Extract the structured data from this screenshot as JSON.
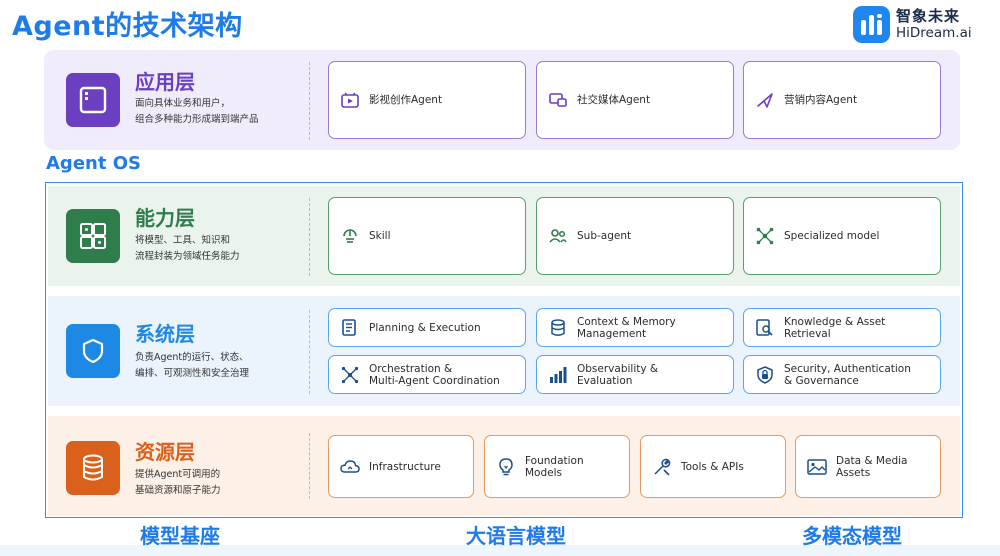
{
  "title": "Agent的技术架构",
  "logo": {
    "cn": "智象未来",
    "en": "HiDream.ai"
  },
  "colors": {
    "title_blue": "#1f7be8",
    "app_purple": "#6a3fc0",
    "cap_green": "#2e7d4a",
    "sys_blue": "#1e88e5",
    "res_orange": "#d9611c"
  },
  "os_label": "Agent OS",
  "layers": {
    "app": {
      "name": "应用层",
      "desc": [
        "面向具体业务和用户，",
        "组合多种能力形成端到端产品"
      ],
      "icon": "app-window-icon",
      "cards": [
        {
          "label": "影视创作Agent",
          "icon": "video-icon"
        },
        {
          "label": "社交媒体Agent",
          "icon": "social-chat-icon"
        },
        {
          "label": "营销内容Agent",
          "icon": "send-arrow-icon"
        }
      ]
    },
    "capability": {
      "name": "能力层",
      "desc": [
        "将模型、工具、知识和",
        "流程封装为领域任务能力"
      ],
      "icon": "grid-blocks-icon",
      "cards": [
        {
          "label": "Skill",
          "icon": "skill-icon"
        },
        {
          "label": "Sub-agent",
          "icon": "users-icon"
        },
        {
          "label": "Specialized model",
          "icon": "network-nodes-icon"
        }
      ]
    },
    "system": {
      "name": "系统层",
      "desc": [
        "负责Agent的运行、状态、",
        "编排、可观测性和安全治理"
      ],
      "icon": "shield-icon",
      "cards": [
        {
          "label": "Planning & Execution",
          "icon": "checklist-icon"
        },
        {
          "label": "Context & Memory\nManagement",
          "icon": "database-icon"
        },
        {
          "label": "Knowledge & Asset\nRetrieval",
          "icon": "document-search-icon"
        },
        {
          "label": "Orchestration &\nMulti-Agent Coordination",
          "icon": "orchestration-icon"
        },
        {
          "label": "Observability &\nEvaluation",
          "icon": "bar-chart-icon"
        },
        {
          "label": "Security, Authentication\n& Governance",
          "icon": "lock-shield-icon"
        }
      ]
    },
    "resource": {
      "name": "资源层",
      "desc": [
        "提供Agent可调用的",
        "基础资源和原子能力"
      ],
      "icon": "database-stack-icon",
      "cards": [
        {
          "label": "Infrastructure",
          "icon": "cloud-icon"
        },
        {
          "label": "Foundation\nModels",
          "icon": "lightbulb-icon"
        },
        {
          "label": "Tools & APIs",
          "icon": "tools-icon"
        },
        {
          "label": "Data & Media\nAssets",
          "icon": "image-icon"
        }
      ]
    }
  },
  "bases": [
    "模型基座",
    "大语言模型",
    "多模态模型"
  ]
}
